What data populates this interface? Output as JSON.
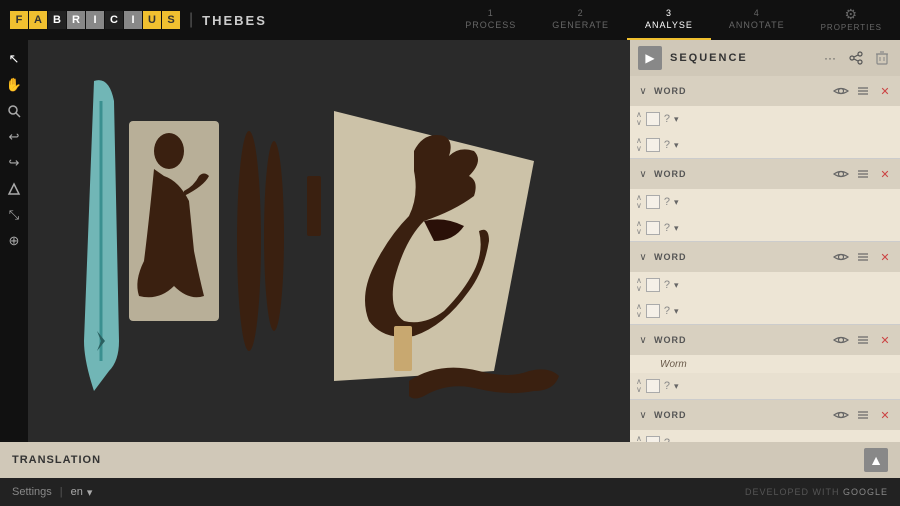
{
  "app": {
    "name": "FABRICIUS",
    "separator": "|",
    "project": "THEBES"
  },
  "logo_letters": [
    {
      "char": "F",
      "style": "yellow"
    },
    {
      "char": "A",
      "style": "yellow"
    },
    {
      "char": "B",
      "style": "dark"
    },
    {
      "char": "R",
      "style": "gray"
    },
    {
      "char": "I",
      "style": "gray"
    },
    {
      "char": "C",
      "style": "dark"
    },
    {
      "char": "I",
      "style": "gray"
    },
    {
      "char": "U",
      "style": "yellow"
    },
    {
      "char": "S",
      "style": "yellow"
    }
  ],
  "nav_steps": [
    {
      "num": "1",
      "label": "PROCESS",
      "active": false
    },
    {
      "num": "2",
      "label": "GENERATE",
      "active": false
    },
    {
      "num": "3",
      "label": "ANALYSE",
      "active": true
    },
    {
      "num": "4",
      "label": "ANNOTATE",
      "active": false
    },
    {
      "num": "⚙",
      "label": "PROPERTIES",
      "active": false,
      "gear": true
    }
  ],
  "tools": [
    {
      "icon": "↖",
      "name": "pointer-tool"
    },
    {
      "icon": "✋",
      "name": "hand-tool"
    },
    {
      "icon": "🔍",
      "name": "zoom-tool"
    },
    {
      "icon": "↩",
      "name": "undo-tool"
    },
    {
      "icon": "↪",
      "name": "redo-tool"
    },
    {
      "icon": "⬡",
      "name": "shape-tool"
    },
    {
      "icon": "⤡",
      "name": "resize-tool"
    },
    {
      "icon": "⊕",
      "name": "add-tool"
    }
  ],
  "panel": {
    "title": "SEQUENCE",
    "arrow_icon": "▶",
    "more_icon": "···",
    "share_icon": "⤢",
    "delete_icon": "🗑"
  },
  "word_groups": [
    {
      "id": "word1",
      "label": "WORD",
      "translation": "",
      "glyphs": [
        {
          "id": "g1a",
          "value": "?"
        },
        {
          "id": "g1b",
          "value": "?"
        }
      ]
    },
    {
      "id": "word2",
      "label": "WORD",
      "translation": "",
      "glyphs": [
        {
          "id": "g2a",
          "value": "?"
        },
        {
          "id": "g2b",
          "value": "?"
        }
      ]
    },
    {
      "id": "word3",
      "label": "WORD",
      "translation": "",
      "glyphs": [
        {
          "id": "g3a",
          "value": "?"
        },
        {
          "id": "g3b",
          "value": "?"
        }
      ]
    },
    {
      "id": "word4",
      "label": "WORD",
      "translation": "Worm",
      "glyphs": [
        {
          "id": "g4a",
          "value": "?"
        }
      ]
    },
    {
      "id": "word5",
      "label": "WORD",
      "translation": "",
      "glyphs": []
    }
  ],
  "bottom_bar": {
    "label": "TRANSLATION",
    "text": ""
  },
  "footer": {
    "settings": "Settings",
    "lang": "en",
    "developed_with": "DEVELOPED WITH",
    "google": "Google"
  }
}
